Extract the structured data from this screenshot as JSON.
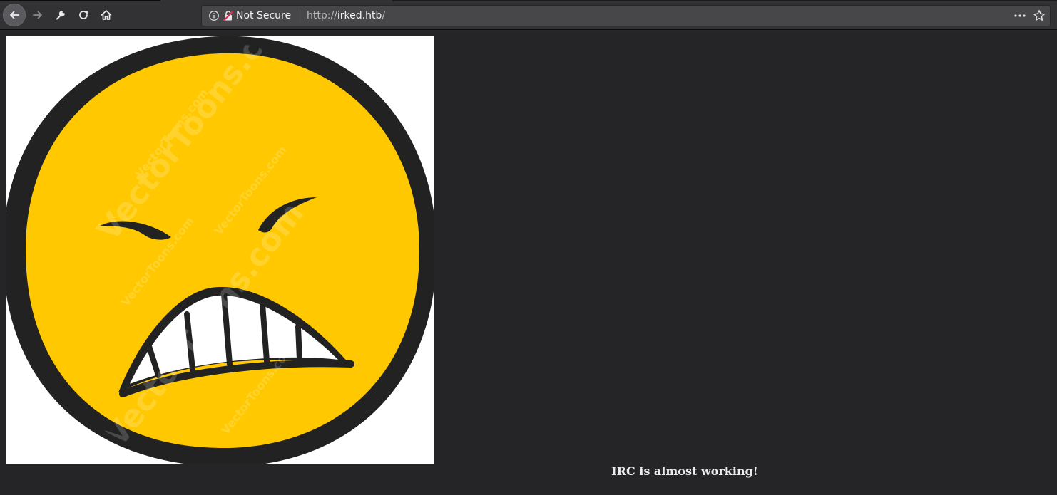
{
  "browser": {
    "security_label": "Not Secure",
    "url_scheme": "http://",
    "url_host": "irked.htb",
    "url_path": "/",
    "icons": {
      "back": "arrow-left-icon",
      "forward": "arrow-right-icon",
      "tools": "wrench-icon",
      "reload": "reload-icon",
      "home": "home-icon",
      "info": "info-icon",
      "insecure": "broken-lock-icon",
      "page_actions": "more-horizontal-icon",
      "bookmark": "star-icon"
    }
  },
  "page": {
    "image_description": "angry-face-emoji",
    "watermark": "VectorToons.com",
    "message": "IRC is almost working!"
  },
  "colors": {
    "page_background": "#252528",
    "toolbar_background": "#323234",
    "face_yellow": "#FFC800",
    "outline": "#222222",
    "message_text": "#ececec"
  }
}
